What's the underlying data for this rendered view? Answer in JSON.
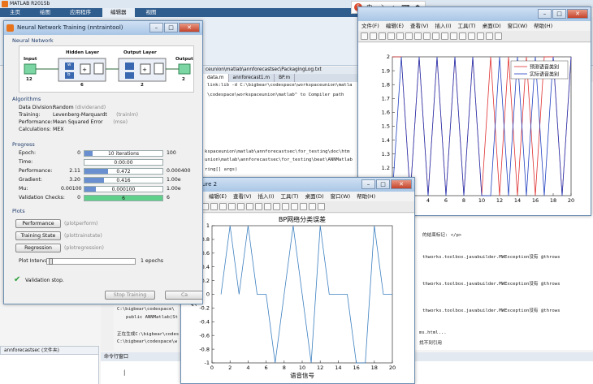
{
  "matlab": {
    "title": "MATLAB R2015b",
    "tabs": [
      "主页",
      "绘图",
      "应用程序",
      "编辑器",
      "视图"
    ],
    "active_tab": 3,
    "file_path": "ceunion\\matlab\\annforecastsec\\PackagingLog.txt",
    "editor_tabs": [
      "data.m",
      "annforecast1.m",
      "BP.m"
    ],
    "code_lines": [
      {
        "text": "link:lib -d C:\\bigbear\\codespace\\workspaceunion\\matla",
        "top": 102,
        "left": 255
      },
      {
        "text": "\\codespace\\workspaceunion\\matlab\" to Compiler path",
        "top": 114,
        "left": 255
      },
      {
        "text": "kspaceunion\\matlab\\annforecastsec\\for_testing\\doc\\htm",
        "top": 184,
        "left": 252
      },
      {
        "text": "union\\matlab\\annforecastsec\\for_testing\\beat\\ANNMatlab",
        "top": 194,
        "left": 252
      },
      {
        "text": "ring[] args)",
        "top": 206,
        "left": 252
      },
      {
        "text": "的结束标记: </p>",
        "top": 285,
        "left": 520
      },
      {
        "text": "thworks.toolbox.javabuilder.MWException没有 @throws",
        "top": 312,
        "left": 520
      },
      {
        "text": "thworks.toolbox.javabuilder.MWException没有 @throws",
        "top": 345,
        "left": 520
      },
      {
        "text": "thworks.toolbox.javabuilder.MWException没有 @throws",
        "top": 378,
        "left": 520
      },
      {
        "text": "C:\\bigbear\\codespace\\",
        "top": 378,
        "left": 144
      },
      {
        "text": "public ANNMatlab(St",
        "top": 388,
        "left": 155
      },
      {
        "text": "正在生成C:\\bigbear\\codes",
        "top": 407,
        "left": 144
      },
      {
        "text": "C:\\bigbear\\codespace\\w",
        "top": 418,
        "left": 144
      },
      {
        "text": "ms.html...",
        "top": 407,
        "left": 516
      },
      {
        "text": "找不到引用",
        "top": 418,
        "left": 516
      }
    ],
    "line_numbers": [
      {
        "n": "29",
        "top": 378
      },
      {
        "n": "30",
        "top": 388
      },
      {
        "n": "31",
        "top": 398
      },
      {
        "n": "32",
        "top": 407
      }
    ],
    "workspace_label": "annforecastsec (文件夹)",
    "command_window": "命令行窗口",
    "prompt": "|"
  },
  "nntool": {
    "title": "Neural Network Training (nntraintool)",
    "sections": {
      "network": "Neural Network",
      "algorithms": "Algorithms",
      "progress": "Progress",
      "plots": "Plots"
    },
    "diagram": {
      "input": "Input",
      "input_n": "12",
      "hidden": "Hidden Layer",
      "hidden_n": "6",
      "output_layer": "Output Layer",
      "output_layer_n": "2",
      "output": "Output",
      "output_n": "2",
      "w": "w",
      "b": "b"
    },
    "algorithms": [
      {
        "label": "Data Division:",
        "value": "Random",
        "note": "(dividerand)"
      },
      {
        "label": "Training:",
        "value": "Levenberg-Marquardt",
        "note": "(trainlm)"
      },
      {
        "label": "Performance:",
        "value": "Mean Squared Error",
        "note": "(mse)"
      },
      {
        "label": "Calculations:",
        "value": "MEX",
        "note": ""
      }
    ],
    "progress": [
      {
        "label": "Epoch:",
        "start": "0",
        "current": "10 iterations",
        "end": "100",
        "fill": 0.1
      },
      {
        "label": "Time:",
        "start": "",
        "current": "0:00:00",
        "end": "",
        "fill": 0
      },
      {
        "label": "Performance:",
        "start": "2.11",
        "current": "0.472",
        "end": "0.000400",
        "fill": 0.3
      },
      {
        "label": "Gradient:",
        "start": "3.20",
        "current": "0.416",
        "end": "1.00e",
        "fill": 0.25
      },
      {
        "label": "Mu:",
        "start": "0.00100",
        "current": "0.000100",
        "end": "1.00e",
        "fill": 0.15
      },
      {
        "label": "Validation Checks:",
        "start": "0",
        "current": "6",
        "end": "6",
        "fill": 1.0
      }
    ],
    "plot_buttons": [
      {
        "label": "Performance",
        "note": "(plotperform)"
      },
      {
        "label": "Training State",
        "note": "(plottrainstate)"
      },
      {
        "label": "Regression",
        "note": "(plotregression)"
      }
    ],
    "plot_interval_label": "Plot Interval:",
    "plot_interval_value": "1 epochs",
    "status": "Validation stop.",
    "stop_button": "Stop Training",
    "cancel_button": "Ca"
  },
  "fig1": {
    "menu": [
      "文件(F)",
      "编辑(E)",
      "查看(V)",
      "插入(I)",
      "工具(T)",
      "桌面(D)",
      "窗口(W)",
      "帮助(H)"
    ]
  },
  "fig2": {
    "title": "Figure 2",
    "menu": [
      "文件(F)",
      "编辑(E)",
      "查看(V)",
      "插入(I)",
      "工具(T)",
      "桌面(D)",
      "窗口(W)",
      "帮助(H)"
    ]
  },
  "chart_data": [
    {
      "type": "line",
      "title": "",
      "xlabel": "",
      "ylabel": "",
      "xlim": [
        0,
        20
      ],
      "ylim": [
        1,
        2
      ],
      "xticks": [
        4,
        6,
        8,
        10,
        12,
        14,
        16,
        18,
        20
      ],
      "yticks": [
        1,
        1.1,
        1.2,
        1.3,
        1.4,
        1.5,
        1.6,
        1.7,
        1.8,
        1.9,
        2
      ],
      "legend": "top-right",
      "series": [
        {
          "name": "预测语音类别",
          "color": "#e03030",
          "x": [
            0,
            1,
            2,
            3,
            4,
            5,
            6,
            7,
            8,
            9,
            10,
            11,
            12,
            13,
            14,
            15,
            16,
            17,
            18,
            19,
            20
          ],
          "y": [
            2,
            2,
            1,
            2,
            1,
            2,
            1,
            2,
            1,
            2,
            1,
            2,
            1,
            2,
            1,
            2,
            1,
            2,
            2,
            1,
            2
          ]
        },
        {
          "name": "实际语音类别",
          "color": "#2040c0",
          "x": [
            0,
            1,
            2,
            3,
            4,
            5,
            6,
            7,
            8,
            9,
            10,
            11,
            12,
            13,
            14,
            15,
            16,
            17,
            18,
            19,
            20
          ],
          "y": [
            1,
            2,
            1,
            2,
            1,
            2,
            1,
            2,
            1,
            2,
            1,
            1,
            2,
            1,
            2,
            1,
            2,
            1,
            2,
            1,
            2
          ]
        }
      ]
    },
    {
      "type": "line",
      "title": "BP网络分类误差",
      "xlabel": "语音信号",
      "ylabel": "分类误差",
      "xlim": [
        0,
        20
      ],
      "ylim": [
        -1,
        1
      ],
      "xticks": [
        0,
        2,
        4,
        6,
        8,
        10,
        12,
        14,
        16,
        18,
        20
      ],
      "yticks": [
        -1,
        -0.8,
        -0.6,
        -0.4,
        -0.2,
        0,
        0.2,
        0.4,
        0.6,
        0.8,
        1
      ],
      "series": [
        {
          "name": "",
          "color": "#3b7fc0",
          "x": [
            1,
            2,
            3,
            4,
            5,
            6,
            7,
            8,
            9,
            10,
            11,
            12,
            13,
            14,
            15,
            16,
            17,
            18,
            19,
            20
          ],
          "y": [
            0,
            1,
            0,
            1,
            0,
            0,
            -1,
            0,
            1,
            0,
            -1,
            1,
            0,
            0,
            0,
            -1,
            -1,
            1,
            0,
            0
          ]
        }
      ]
    }
  ]
}
